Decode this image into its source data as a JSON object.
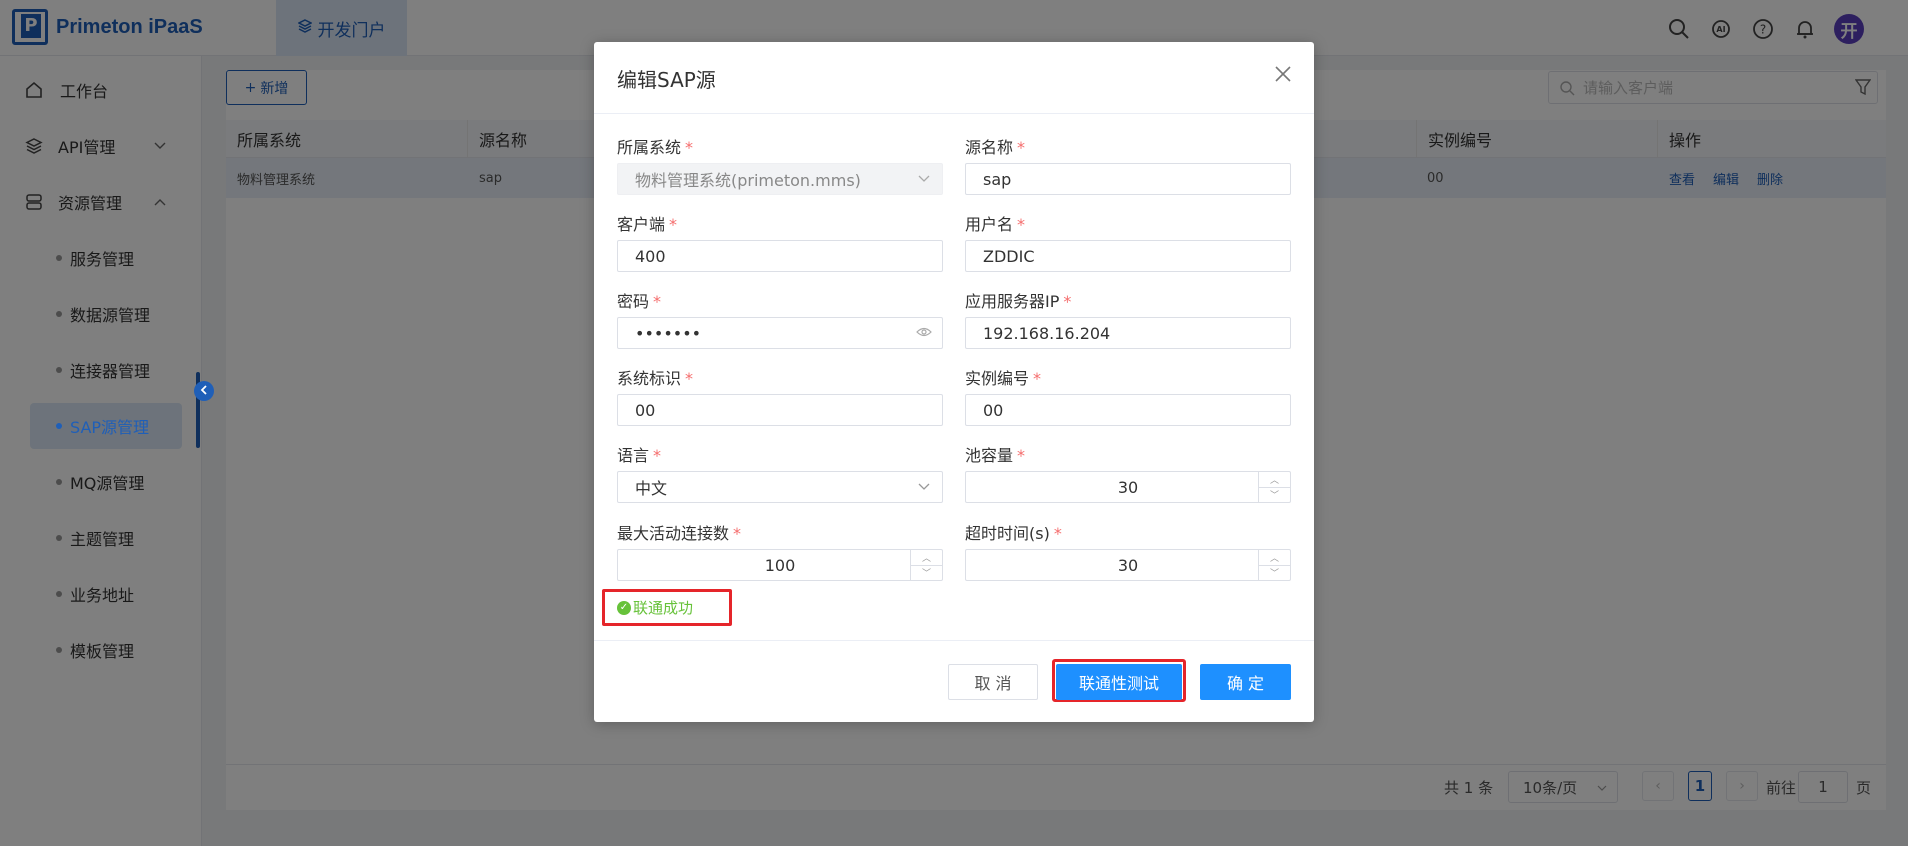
{
  "app": {
    "brand": "Primeton iPaaS",
    "top_tab": "开发门户",
    "avatar_text": "开"
  },
  "sidebar": {
    "items": [
      {
        "label": "工作台"
      },
      {
        "label": "API管理"
      },
      {
        "label": "资源管理"
      }
    ],
    "sub_items": [
      {
        "label": "服务管理"
      },
      {
        "label": "数据源管理"
      },
      {
        "label": "连接器管理"
      },
      {
        "label": "SAP源管理"
      },
      {
        "label": "MQ源管理"
      },
      {
        "label": "主题管理"
      },
      {
        "label": "业务地址"
      },
      {
        "label": "模板管理"
      }
    ]
  },
  "toolbar": {
    "add_label": "新增",
    "search_placeholder": "请输入客户端"
  },
  "table": {
    "headers": [
      "所属系统",
      "源名称",
      "实例编号",
      "操作"
    ],
    "rows": [
      {
        "system": "物料管理系统",
        "name": "sap",
        "instance": "00"
      }
    ],
    "actions": [
      "查看",
      "编辑",
      "删除"
    ]
  },
  "pager": {
    "total": "共 1 条",
    "page_size": "10条/页",
    "current": "1",
    "goto_label": "前往",
    "goto_value": "1",
    "page_suffix": "页"
  },
  "modal": {
    "title": "编辑SAP源",
    "fields": {
      "system": {
        "label": "所属系统",
        "value": "物料管理系统(primeton.mms)"
      },
      "name": {
        "label": "源名称",
        "value": "sap"
      },
      "client": {
        "label": "客户端",
        "value": "400"
      },
      "username": {
        "label": "用户名",
        "value": "ZDDIC"
      },
      "password": {
        "label": "密码",
        "value": "•••••••"
      },
      "server_ip": {
        "label": "应用服务器IP",
        "value": "192.168.16.204"
      },
      "system_id": {
        "label": "系统标识",
        "value": "00"
      },
      "instance_no": {
        "label": "实例编号",
        "value": "00"
      },
      "language": {
        "label": "语言",
        "value": "中文"
      },
      "pool_size": {
        "label": "池容量",
        "value": "30"
      },
      "max_connections": {
        "label": "最大活动连接数",
        "value": "100"
      },
      "timeout": {
        "label": "超时时间(s)",
        "value": "30"
      }
    },
    "success_text": "联通成功",
    "buttons": {
      "cancel": "取 消",
      "test": "联通性测试",
      "ok": "确 定"
    }
  },
  "colors": {
    "primary": "#1f5fb8",
    "button_blue": "#1e90ff",
    "success": "#67c23a",
    "highlight_red": "#e5252a",
    "required": "#f56c6c"
  }
}
